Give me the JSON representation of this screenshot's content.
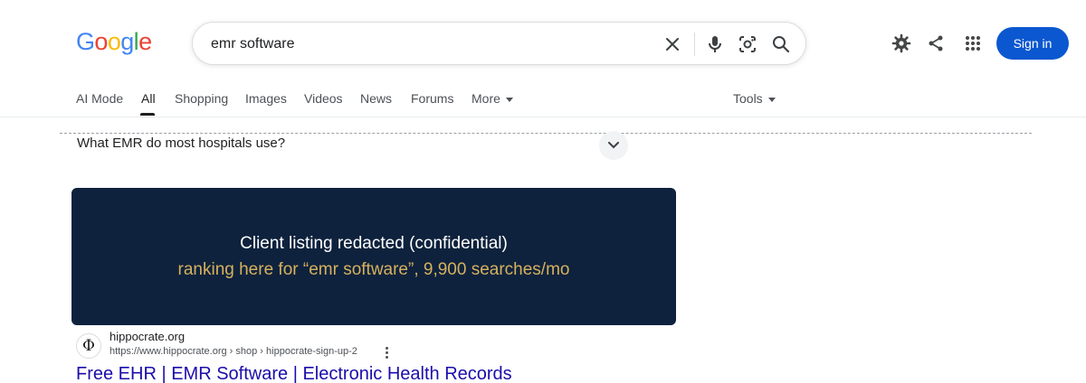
{
  "logo": {
    "letters": [
      "G",
      "o",
      "o",
      "g",
      "l",
      "e"
    ],
    "colors": [
      "#4285f4",
      "#ea4335",
      "#fbbc05",
      "#4285f4",
      "#34a853",
      "#ea4335"
    ]
  },
  "search": {
    "query": "emr software"
  },
  "header": {
    "signin_label": "Sign in",
    "accent": "#0b57d0"
  },
  "tabs": [
    {
      "label": "AI Mode"
    },
    {
      "label": "All"
    },
    {
      "label": "Shopping"
    },
    {
      "label": "Images"
    },
    {
      "label": "Videos"
    },
    {
      "label": "News"
    },
    {
      "label": "Forums"
    },
    {
      "label": "More"
    }
  ],
  "tools_label": "Tools",
  "paa": {
    "question": "What EMR do most hospitals use?"
  },
  "redacted": {
    "line1": "Client listing redacted (confidential)",
    "line2": "ranking here for “emr software”, 9,900 searches/mo",
    "background": "#0e223d",
    "highlight": "#d6b15e"
  },
  "result": {
    "favicon_glyph": "Φ",
    "site_name": "hippocrate.org",
    "url": "https://www.hippocrate.org › shop › hippocrate-sign-up-2",
    "title": "Free EHR | EMR Software | Electronic Health Records",
    "link_color": "#1a0dab"
  }
}
